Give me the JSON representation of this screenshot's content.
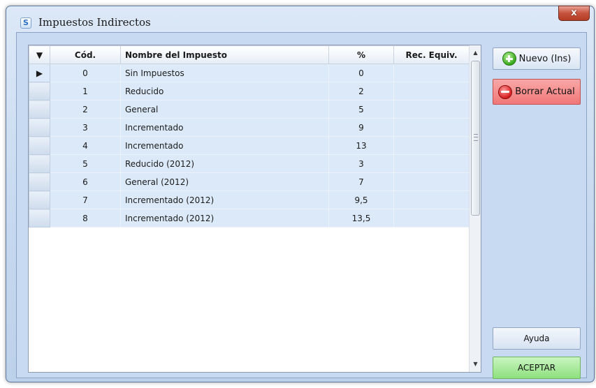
{
  "window": {
    "title": "Impuestos Indirectos",
    "close_label": "x"
  },
  "grid": {
    "columns": {
      "indicator": "▼",
      "code": "Cód.",
      "name": "Nombre del Impuesto",
      "percent": "%",
      "rec_equiv": "Rec. Equiv."
    },
    "current_row_marker": "▶",
    "rows": [
      {
        "code": "0",
        "name": "Sin Impuestos",
        "percent": "0",
        "rec_equiv": ""
      },
      {
        "code": "1",
        "name": "Reducido",
        "percent": "2",
        "rec_equiv": ""
      },
      {
        "code": "2",
        "name": "General",
        "percent": "5",
        "rec_equiv": ""
      },
      {
        "code": "3",
        "name": "Incrementado",
        "percent": "9",
        "rec_equiv": ""
      },
      {
        "code": "4",
        "name": "Incrementado",
        "percent": "13",
        "rec_equiv": ""
      },
      {
        "code": "5",
        "name": "Reducido (2012)",
        "percent": "3",
        "rec_equiv": ""
      },
      {
        "code": "6",
        "name": "General (2012)",
        "percent": "7",
        "rec_equiv": ""
      },
      {
        "code": "7",
        "name": "Incrementado (2012)",
        "percent": "9,5",
        "rec_equiv": ""
      },
      {
        "code": "8",
        "name": "Incrementado (2012)",
        "percent": "13,5",
        "rec_equiv": ""
      }
    ]
  },
  "scrollbar": {
    "up_arrow": "▲",
    "down_arrow": "▼"
  },
  "buttons": {
    "new_label": "Nuevo (Ins)",
    "delete_label": "Borrar Actual",
    "help_label": "Ayuda",
    "accept_label": "ACEPTAR"
  },
  "icons": {
    "app": "app-s-icon",
    "new": "plus-circle-icon",
    "delete": "minus-circle-icon"
  },
  "colors": {
    "row_bg": "#dbe9f8",
    "delete_button": "#f07777",
    "accept_button": "#8ee07e",
    "title_bar": "#c5d8ef"
  }
}
